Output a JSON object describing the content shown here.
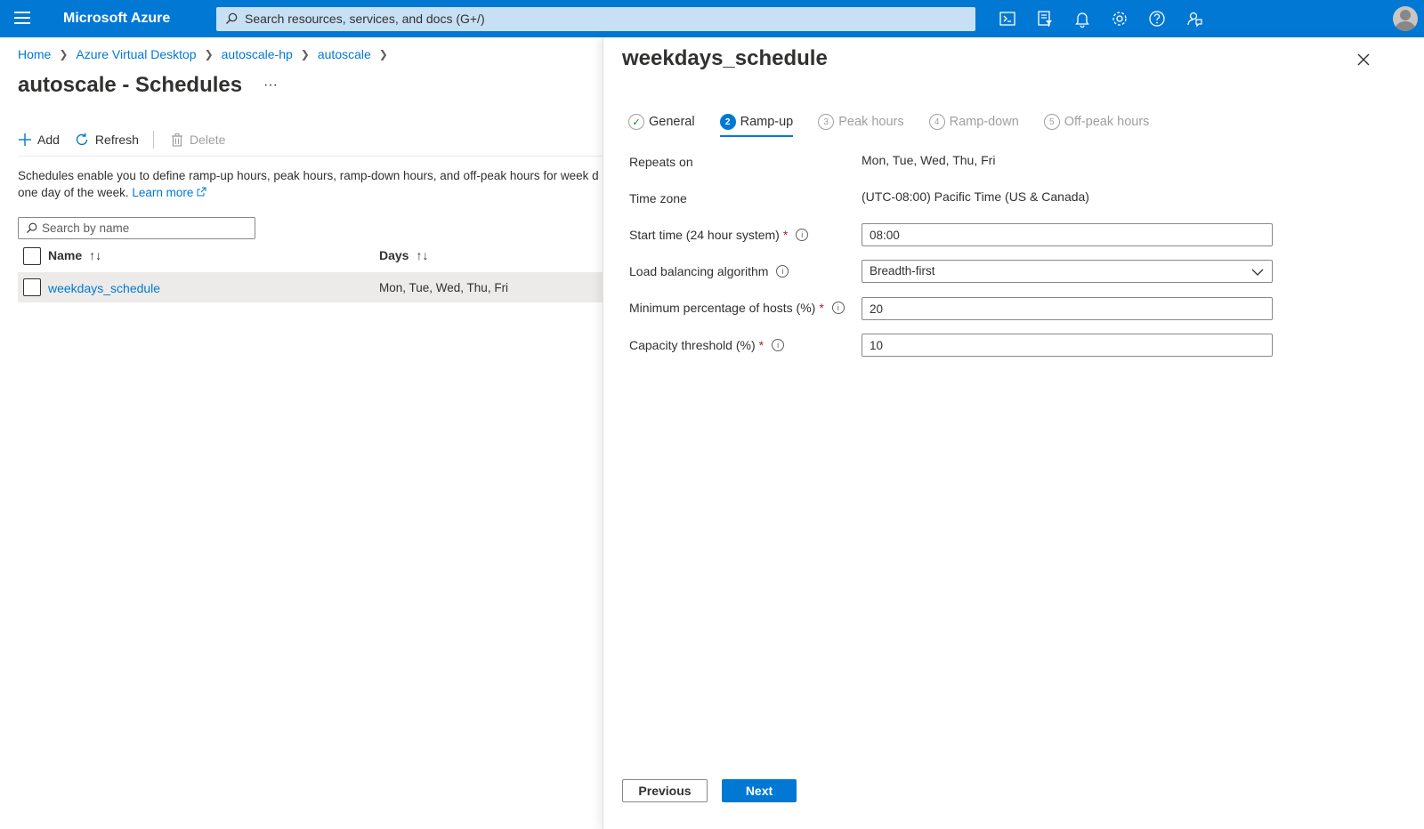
{
  "topbar": {
    "brand": "Microsoft Azure",
    "search_placeholder": "Search resources, services, and docs (G+/)",
    "icons": [
      "hamburger-icon",
      "cloud-shell-icon",
      "directory-filter-icon",
      "notifications-icon",
      "settings-icon",
      "help-icon",
      "feedback-icon",
      "avatar"
    ]
  },
  "breadcrumb": [
    "Home",
    "Azure Virtual Desktop",
    "autoscale-hp",
    "autoscale"
  ],
  "page": {
    "title": "autoscale - Schedules",
    "ellipsis": "···"
  },
  "toolbar": {
    "add": "Add",
    "refresh": "Refresh",
    "delete": "Delete"
  },
  "description": {
    "text": "Schedules enable you to define ramp-up hours, peak hours, ramp-down hours, and off-peak hours for week d",
    "text2": "one day of the week.",
    "link": "Learn more"
  },
  "list": {
    "search_placeholder": "Search by name",
    "columns": [
      "Name",
      "Days"
    ],
    "rows": [
      {
        "name": "weekdays_schedule",
        "days": "Mon, Tue, Wed, Thu, Fri"
      }
    ]
  },
  "panel": {
    "title": "weekdays_schedule",
    "tabs": [
      {
        "num": "✓",
        "label": "General",
        "state": "done"
      },
      {
        "num": "2",
        "label": "Ramp-up",
        "state": "active"
      },
      {
        "num": "3",
        "label": "Peak hours",
        "state": "pending"
      },
      {
        "num": "4",
        "label": "Ramp-down",
        "state": "pending"
      },
      {
        "num": "5",
        "label": "Off-peak hours",
        "state": "pending"
      }
    ],
    "fields": {
      "repeats_on_label": "Repeats on",
      "repeats_on_value": "Mon, Tue, Wed, Thu, Fri",
      "timezone_label": "Time zone",
      "timezone_value": "(UTC-08:00) Pacific Time (US & Canada)",
      "start_time_label": "Start time (24 hour system)",
      "start_time_value": "08:00",
      "lb_label": "Load balancing algorithm",
      "lb_value": "Breadth-first",
      "min_hosts_label": "Minimum percentage of hosts (%)",
      "min_hosts_value": "20",
      "capacity_label": "Capacity threshold (%)",
      "capacity_value": "10",
      "required_mark": "*",
      "info_mark": "i"
    },
    "buttons": {
      "previous": "Previous",
      "next": "Next"
    }
  },
  "colors": {
    "accent": "#0078d4",
    "required": "#a4262c",
    "row_selected": "#edebe9"
  }
}
